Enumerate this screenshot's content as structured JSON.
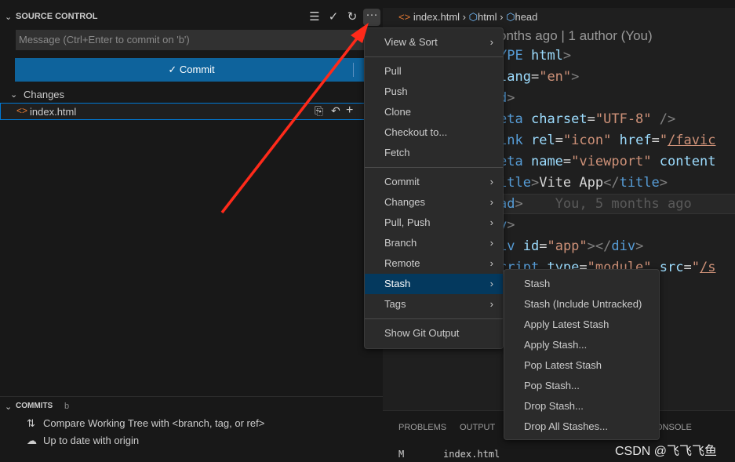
{
  "sidebar": {
    "title": "SOURCE CONTROL",
    "message_placeholder": "Message (Ctrl+Enter to commit on 'b')",
    "commit_label": "Commit",
    "changes_label": "Changes",
    "file": "index.html",
    "commits_title": "COMMITS",
    "commits_branch": "b",
    "compare": "Compare Working Tree with <branch, tag, or ref>",
    "status": "Up to date with origin"
  },
  "breadcrumb": {
    "file": "index.html",
    "el1": "html",
    "el2": "head"
  },
  "editor": {
    "codelens": "onths ago | 1 author (You)",
    "blame": "You, 5 months ago"
  },
  "panel": {
    "tabs": [
      "PROBLEMS",
      "OUTPUT",
      "ONSOLE"
    ],
    "status": "M",
    "file": "index.html"
  },
  "menu": {
    "items": [
      "View & Sort",
      "Pull",
      "Push",
      "Clone",
      "Checkout to...",
      "Fetch",
      "Commit",
      "Changes",
      "Pull, Push",
      "Branch",
      "Remote",
      "Stash",
      "Tags",
      "Show Git Output"
    ]
  },
  "submenu": {
    "items": [
      "Stash",
      "Stash (Include Untracked)",
      "Apply Latest Stash",
      "Apply Stash...",
      "Pop Latest Stash",
      "Pop Stash...",
      "Drop Stash...",
      "Drop All Stashes..."
    ]
  },
  "watermark": "CSDN @飞飞飞鱼",
  "colors": {
    "accent": "#0e639c",
    "arrow": "#ff2a1a",
    "selected": "#04395e"
  }
}
